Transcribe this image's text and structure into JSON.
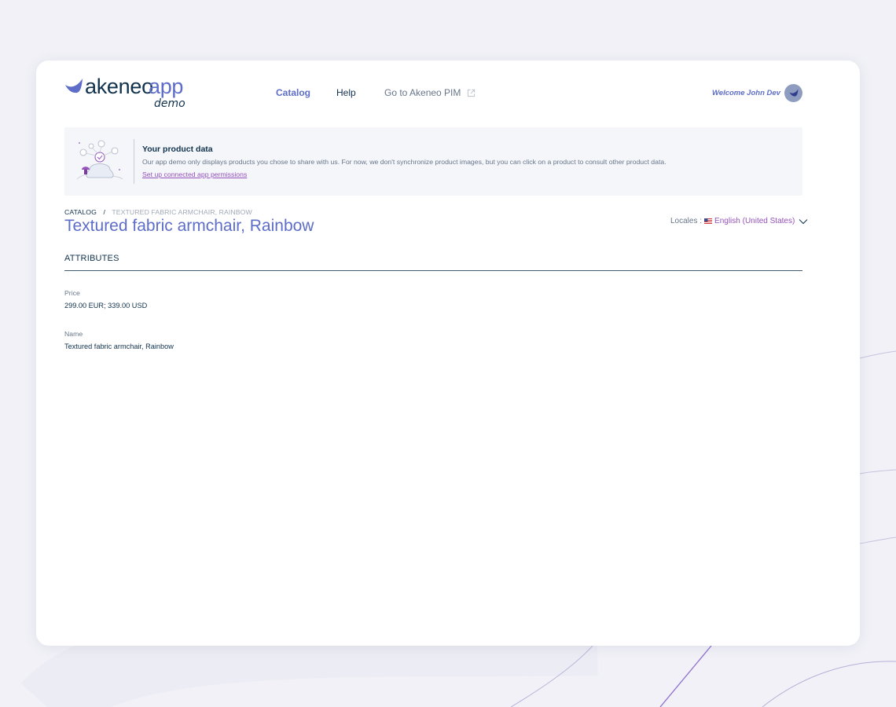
{
  "header": {
    "logo": {
      "brand": "akeneo",
      "product": "app",
      "subtitle": "demo"
    },
    "nav": [
      {
        "label": "Catalog"
      },
      {
        "label": "Help"
      },
      {
        "label": "Go to Akeneo PIM"
      }
    ],
    "welcome": "Welcome John Dev"
  },
  "banner": {
    "title": "Your product data",
    "text": "Our app demo only displays products you chose to share with us. For now, we don't synchronize product images, but you can click on a product to consult other product data.",
    "link": "Set up connected app permissions"
  },
  "breadcrumb": {
    "root": "CATALOG",
    "separator": "/",
    "current": "TEXTURED FABRIC ARMCHAIR, RAINBOW"
  },
  "product": {
    "title": "Textured fabric armchair, Rainbow"
  },
  "locales": {
    "label": "Locales :",
    "value": "English (United States)"
  },
  "attributes": {
    "section_title": "ATTRIBUTES",
    "items": [
      {
        "label": "Price",
        "value": "299.00 EUR; 339.00 USD"
      },
      {
        "label": "Name",
        "value": "Textured fabric armchair, Rainbow"
      }
    ]
  },
  "colors": {
    "accent": "#5d6dc8",
    "text": "#11324d",
    "link": "#9452ba",
    "background": "#f1f1f7"
  }
}
